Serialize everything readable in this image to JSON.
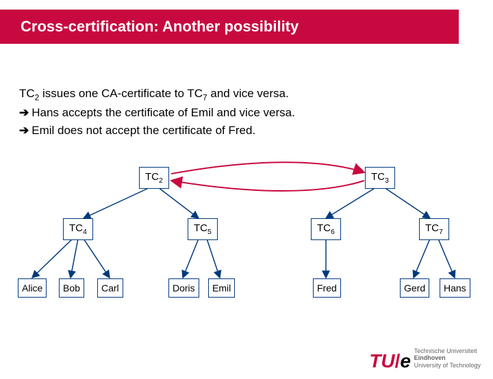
{
  "title": "Cross-certification: Another possibility",
  "lines": {
    "l1a": "TC",
    "l1b": " issues one CA-certificate to TC",
    "l1c": " and vice versa.",
    "l2": "Hans accepts the certificate of Emil and vice versa.",
    "l3": "Emil does not accept the certificate of Fred."
  },
  "sub_tc2": "2",
  "sub_tc7": "7",
  "nodes": {
    "tc2": "TC",
    "tc2s": "2",
    "tc3": "TC",
    "tc3s": "3",
    "tc4": "TC",
    "tc4s": "4",
    "tc5": "TC",
    "tc5s": "5",
    "tc6": "TC",
    "tc6s": "6",
    "tc7": "TC",
    "tc7s": "7",
    "alice": "Alice",
    "bob": "Bob",
    "carl": "Carl",
    "doris": "Doris",
    "emil": "Emil",
    "fred": "Fred",
    "gerd": "Gerd",
    "hans": "Hans"
  },
  "footer": {
    "l1": "Technische Universiteit",
    "l2": "Eindhoven",
    "l3": "University of Technology"
  },
  "logo": {
    "t": "TU",
    "slash": "/",
    "e": "e"
  }
}
